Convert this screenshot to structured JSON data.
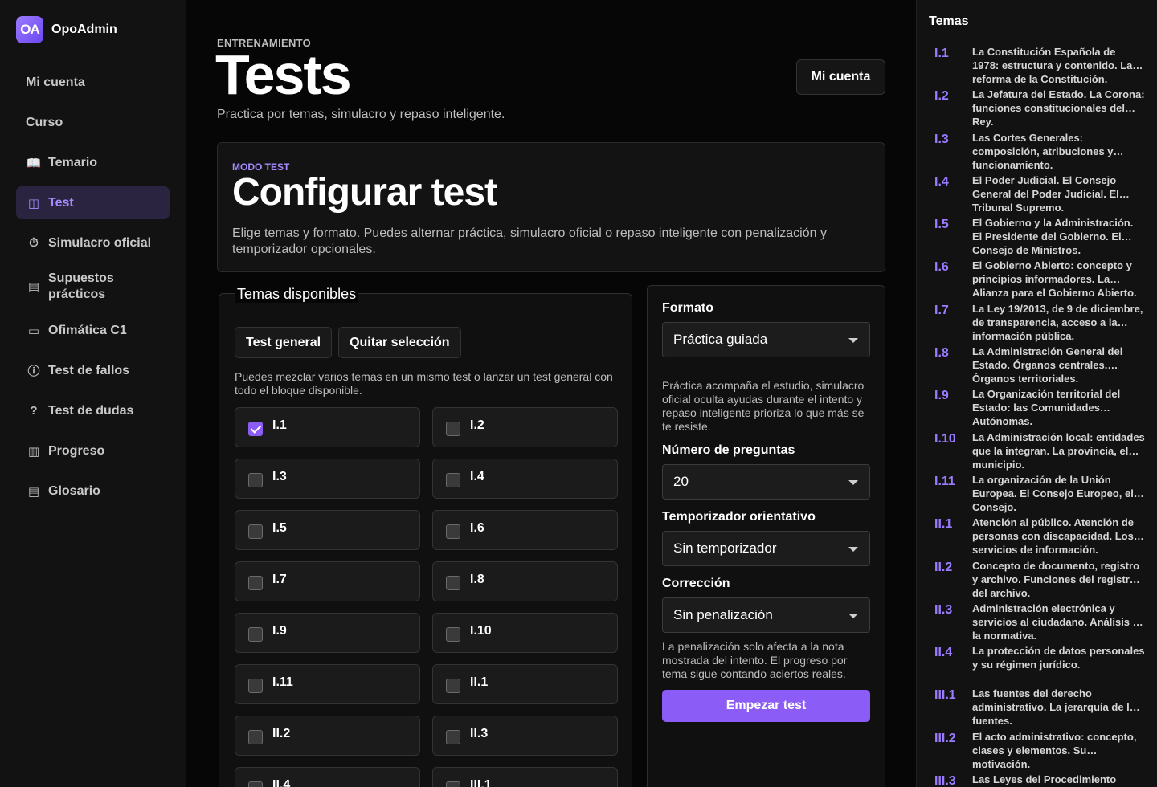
{
  "brand": {
    "logo": "OA",
    "name": "OpoAdmin"
  },
  "nav": [
    {
      "label": "Mi cuenta",
      "icon": "",
      "active": false
    },
    {
      "label": "Curso",
      "icon": "",
      "active": false
    },
    {
      "label": "Temario",
      "icon": "book-icon",
      "active": false
    },
    {
      "label": "Test",
      "icon": "quiz-icon",
      "active": true
    },
    {
      "label": "Simulacro oficial",
      "icon": "stopwatch-icon",
      "active": false
    },
    {
      "label": "Supuestos prácticos",
      "icon": "clipboard-icon",
      "active": false
    },
    {
      "label": "Ofimática C1",
      "icon": "laptop-icon",
      "active": false
    },
    {
      "label": "Test de fallos",
      "icon": "alert-icon",
      "active": false
    },
    {
      "label": "Test de dudas",
      "icon": "help-icon",
      "active": false
    },
    {
      "label": "Progreso",
      "icon": "chart-icon",
      "active": false
    },
    {
      "label": "Glosario",
      "icon": "library-icon",
      "active": false
    }
  ],
  "header": {
    "eyebrow": "ENTRENAMIENTO",
    "title": "Tests",
    "subtitle": "Practica por temas, simulacro y repaso inteligente.",
    "account_button": "Mi cuenta"
  },
  "config": {
    "mode_label": "MODO TEST",
    "title": "Configurar test",
    "description": "Elige temas y formato. Puedes alternar práctica, simulacro oficial o repaso inteligente con penalización y temporizador opcionales."
  },
  "topics": {
    "legend": "Temas disponibles",
    "general_button": "Test general",
    "clear_button": "Quitar selección",
    "hint": "Puedes mezclar varios temas en un mismo test o lanzar un test general con todo el bloque disponible.",
    "items": [
      {
        "code": "I.1",
        "checked": true
      },
      {
        "code": "I.2",
        "checked": false
      },
      {
        "code": "I.3",
        "checked": false
      },
      {
        "code": "I.4",
        "checked": false
      },
      {
        "code": "I.5",
        "checked": false
      },
      {
        "code": "I.6",
        "checked": false
      },
      {
        "code": "I.7",
        "checked": false
      },
      {
        "code": "I.8",
        "checked": false
      },
      {
        "code": "I.9",
        "checked": false
      },
      {
        "code": "I.10",
        "checked": false
      },
      {
        "code": "I.11",
        "checked": false
      },
      {
        "code": "II.1",
        "checked": false
      },
      {
        "code": "II.2",
        "checked": false
      },
      {
        "code": "II.3",
        "checked": false
      },
      {
        "code": "II.4",
        "checked": false
      },
      {
        "code": "III.1",
        "checked": false
      }
    ]
  },
  "settings": {
    "format_label": "Formato",
    "format_value": "Práctica guiada",
    "format_hint": "Práctica acompaña el estudio, simulacro oficial oculta ayudas durante el intento y repaso inteligente prioriza lo que más se te resiste.",
    "questions_label": "Número de preguntas",
    "questions_value": "20",
    "timer_label": "Temporizador orientativo",
    "timer_value": "Sin temporizador",
    "correction_label": "Corrección",
    "correction_value": "Sin penalización",
    "correction_hint": "La penalización solo afecta a la nota mostrada del intento. El progreso por tema sigue contando aciertos reales.",
    "start_button": "Empezar test"
  },
  "temas_panel": {
    "title": "Temas",
    "items": [
      {
        "code": "I.1",
        "text": "La Constitución Española de 1978: estructura y contenido. La reforma de la Constitución."
      },
      {
        "code": "I.2",
        "text": "La Jefatura del Estado. La Corona: funciones constitucionales del Rey."
      },
      {
        "code": "I.3",
        "text": "Las Cortes Generales: composición, atribuciones y funcionamiento."
      },
      {
        "code": "I.4",
        "text": "El Poder Judicial. El Consejo General del Poder Judicial. El Tribunal Supremo."
      },
      {
        "code": "I.5",
        "text": "El Gobierno y la Administración. El Presidente del Gobierno. El Consejo de Ministros."
      },
      {
        "code": "I.6",
        "text": "El Gobierno Abierto: concepto y principios informadores. La Alianza para el Gobierno Abierto."
      },
      {
        "code": "I.7",
        "text": "La Ley 19/2013, de 9 de diciembre, de transparencia, acceso a la información pública."
      },
      {
        "code": "I.8",
        "text": "La Administración General del Estado. Órganos centrales. Órganos territoriales."
      },
      {
        "code": "I.9",
        "text": "La Organización territorial del Estado: las Comunidades Autónomas."
      },
      {
        "code": "I.10",
        "text": "La Administración local: entidades que la integran. La provincia, el municipio."
      },
      {
        "code": "I.11",
        "text": "La organización de la Unión Europea. El Consejo Europeo, el Consejo."
      },
      {
        "code": "II.1",
        "text": "Atención al público. Atención de personas con discapacidad. Los servicios de información."
      },
      {
        "code": "II.2",
        "text": "Concepto de documento, registro y archivo. Funciones del registro y del archivo."
      },
      {
        "code": "II.3",
        "text": "Administración electrónica y servicios al ciudadano. Análisis de la normativa."
      },
      {
        "code": "II.4",
        "text": "La protección de datos personales y su régimen jurídico."
      },
      {
        "code": "III.1",
        "text": "Las fuentes del derecho administrativo. La jerarquía de las fuentes."
      },
      {
        "code": "III.2",
        "text": "El acto administrativo: concepto, clases y elementos. Su motivación."
      },
      {
        "code": "III.3",
        "text": "Las Leyes del Procedimiento Administrativo Común."
      }
    ]
  }
}
